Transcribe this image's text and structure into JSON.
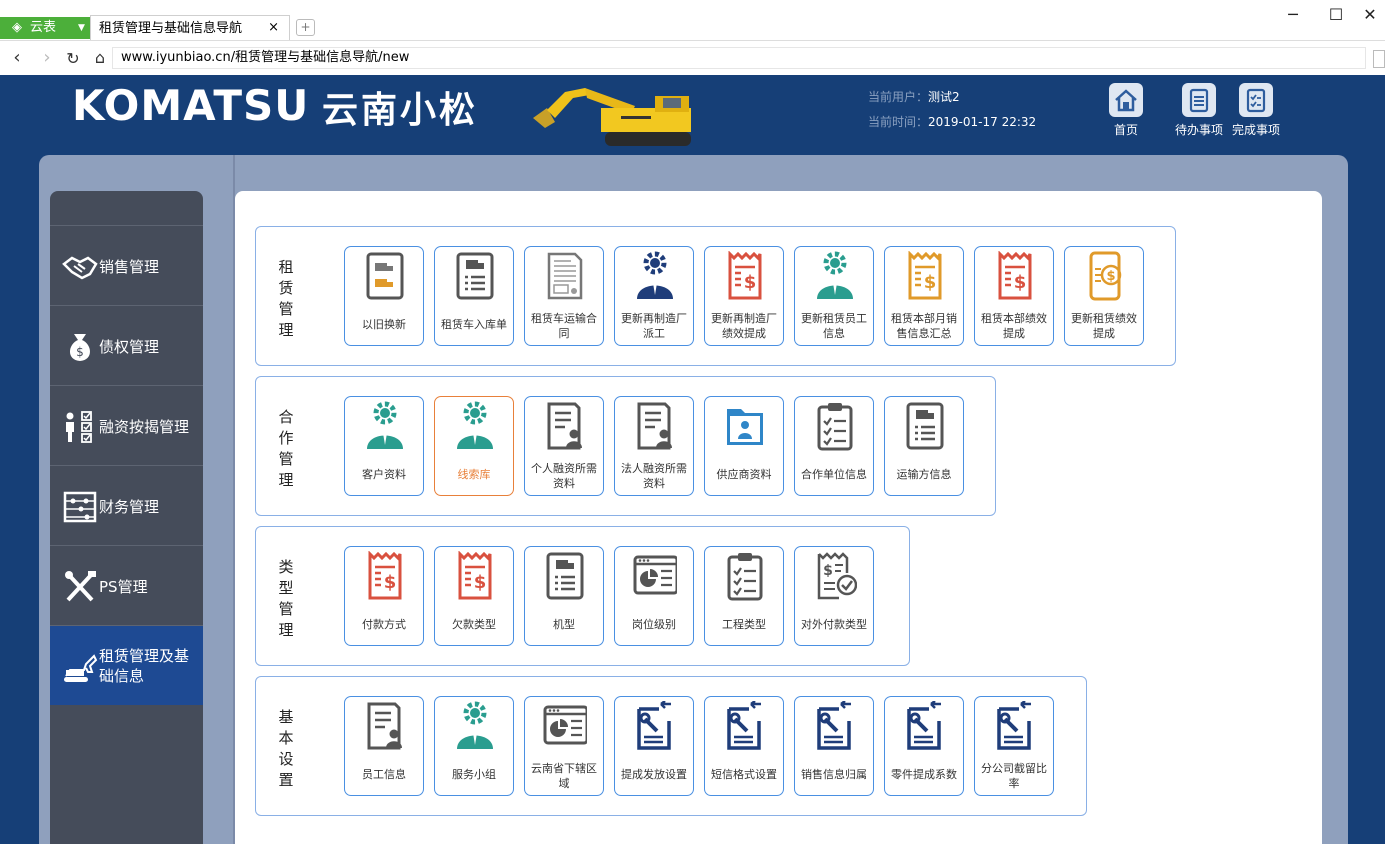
{
  "browser": {
    "app_menu_label": "云表",
    "tab_title": "租赁管理与基础信息导航",
    "tab_close": "×",
    "url_domain": "www.iyunbiao.cn",
    "url_path": "/租赁管理与基础信息导航/new"
  },
  "header": {
    "brand": "KOMATSU",
    "brand_cn": "云南小松",
    "user_label": "当前用户：",
    "user_value": "测试2",
    "time_label": "当前时间：",
    "time_value": "2019-01-17 22:32",
    "nav": [
      "首页",
      "待办事项",
      "完成事项"
    ]
  },
  "sidebar": {
    "items": [
      {
        "label": "销售管理",
        "icon": "handshake-icon"
      },
      {
        "label": "债权管理",
        "icon": "money-bag-icon"
      },
      {
        "label": "融资按揭管理",
        "icon": "checklist-person-icon"
      },
      {
        "label": "财务管理",
        "icon": "abacus-icon"
      },
      {
        "label": "PS管理",
        "icon": "tools-icon"
      },
      {
        "label": "租赁管理及基础信息",
        "icon": "excavator-icon",
        "active": true
      }
    ]
  },
  "groups": [
    {
      "title": "租赁管理",
      "cards": [
        {
          "label": "以旧换新",
          "icon": "truck-doc-icon"
        },
        {
          "label": "租赁车入库单",
          "icon": "truck-list-icon"
        },
        {
          "label": "租赁车运输合同",
          "icon": "contract-icon"
        },
        {
          "label": "更新再制造厂派工",
          "icon": "worker-gear-icon"
        },
        {
          "label": "更新再制造厂绩效提成",
          "icon": "dollar-receipt-icon"
        },
        {
          "label": "更新租赁员工信息",
          "icon": "employee-gear-icon"
        },
        {
          "label": "租赁本部月销售信息汇总",
          "icon": "dollar-receipt-icon"
        },
        {
          "label": "租赁本部绩效提成",
          "icon": "dollar-receipt-icon"
        },
        {
          "label": "更新租赁绩效提成",
          "icon": "dollar-phone-icon"
        }
      ]
    },
    {
      "title": "合作管理",
      "cards": [
        {
          "label": "客户资料",
          "icon": "employee-gear-icon"
        },
        {
          "label": "线索库",
          "icon": "employee-gear-icon",
          "selected": true
        },
        {
          "label": "个人融资所需资料",
          "icon": "person-doc-icon"
        },
        {
          "label": "法人融资所需资料",
          "icon": "person-doc-icon"
        },
        {
          "label": "供应商资料",
          "icon": "folder-person-icon"
        },
        {
          "label": "合作单位信息",
          "icon": "clipboard-check-icon"
        },
        {
          "label": "运输方信息",
          "icon": "truck-list-icon"
        }
      ]
    },
    {
      "title": "类型管理",
      "cards": [
        {
          "label": "付款方式",
          "icon": "dollar-receipt-icon"
        },
        {
          "label": "欠款类型",
          "icon": "dollar-receipt-icon"
        },
        {
          "label": "机型",
          "icon": "truck-list-icon"
        },
        {
          "label": "岗位级别",
          "icon": "chart-window-icon"
        },
        {
          "label": "工程类型",
          "icon": "clipboard-check-icon"
        },
        {
          "label": "对外付款类型",
          "icon": "dollar-check-icon"
        }
      ]
    },
    {
      "title": "基本设置",
      "cards": [
        {
          "label": "员工信息",
          "icon": "person-doc-icon"
        },
        {
          "label": "服务小组",
          "icon": "employee-gear-icon"
        },
        {
          "label": "云南省下辖区域",
          "icon": "chart-window-icon"
        },
        {
          "label": "提成发放设置",
          "icon": "wrench-doc-icon"
        },
        {
          "label": "短信格式设置",
          "icon": "wrench-doc-icon"
        },
        {
          "label": "销售信息归属",
          "icon": "wrench-doc-icon"
        },
        {
          "label": "零件提成系数",
          "icon": "wrench-doc-icon"
        },
        {
          "label": "分公司截留比率",
          "icon": "wrench-doc-icon"
        }
      ]
    }
  ],
  "colors": {
    "page_bg": "#163f77",
    "sidebar_bg": "#454c5a",
    "sidebar_active": "#1e4a93",
    "card_border": "#4a90e2",
    "card_selected": "#e8803a",
    "teal": "#2a9d8f",
    "red": "#d9513f",
    "orange": "#e09a2a",
    "navy": "#1f3d7a"
  }
}
